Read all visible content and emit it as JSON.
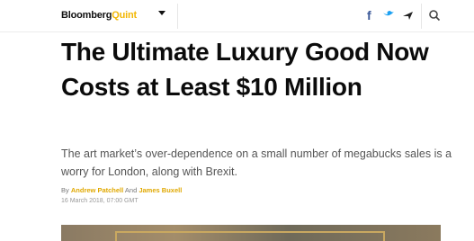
{
  "header": {
    "brand_part1": "Bloomberg",
    "brand_part2": "Quint",
    "menu_icon": "chevron-down-icon",
    "share_icons": [
      "facebook-icon",
      "twitter-icon",
      "send-icon"
    ],
    "search_icon": "search-icon",
    "colors": {
      "brand_accent": "#f2b705",
      "facebook": "#3b5998",
      "twitter": "#1da1f2"
    }
  },
  "article": {
    "headline": "The Ultimate Luxury Good Now Costs at Least $10 Million",
    "dek": "The art market’s over-dependence on a small number of megabucks sales is a worry for London, along with Brexit.",
    "byline_prefix": "By",
    "author1": "Andrew Patchell",
    "byline_and": "And",
    "author2": "James Buxell",
    "timestamp": "16 March 2018, 07:00 GMT"
  }
}
